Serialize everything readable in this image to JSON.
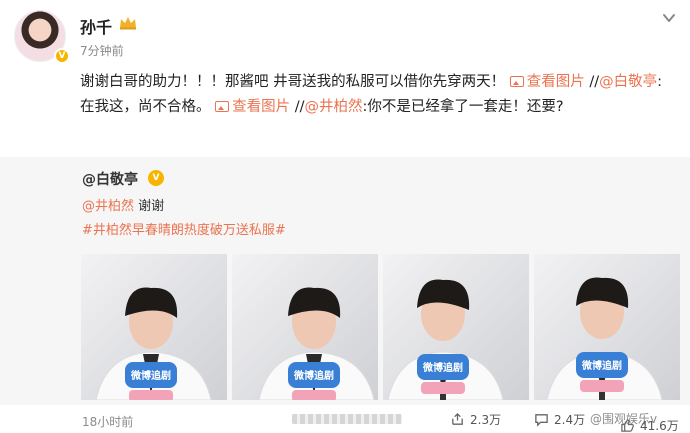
{
  "post": {
    "username": "孙千",
    "time": "7分钟前",
    "text": {
      "p1": "谢谢白哥的助力！！！那酱吧 井哥送我的私服可以借你先穿两天！",
      "viewpic": "查看图片",
      "p2": " //",
      "mention1": "@白敬亭",
      "p3": ":在我这，尚不合格。",
      "p4": " //",
      "mention2": "@井柏然",
      "p5": ":你不是已经拿了一套走！还要?"
    }
  },
  "repost": {
    "username": "@白敬亭",
    "mention": "@井柏然",
    "thanks": "谢谢",
    "hashtag": "#井柏然早春晴朗热度破万送私服#",
    "photo_sign_text": "微博追剧",
    "photo_count": 4
  },
  "footer": {
    "time": "18小时前",
    "share_count": "2.3万",
    "comment_count": "2.4万",
    "like_count": "41.6万",
    "watermark": "@围观娱乐v"
  },
  "icons": {
    "avatar_badge": "verified-v-icon",
    "crown": "crown-icon",
    "more": "chevron-down-icon",
    "share": "share-icon",
    "comment": "comment-icon",
    "like": "thumb-up-icon"
  },
  "colors": {
    "accent": "#eb7350",
    "badge": "#f7b500",
    "repost_bg": "#f6f6f6"
  }
}
